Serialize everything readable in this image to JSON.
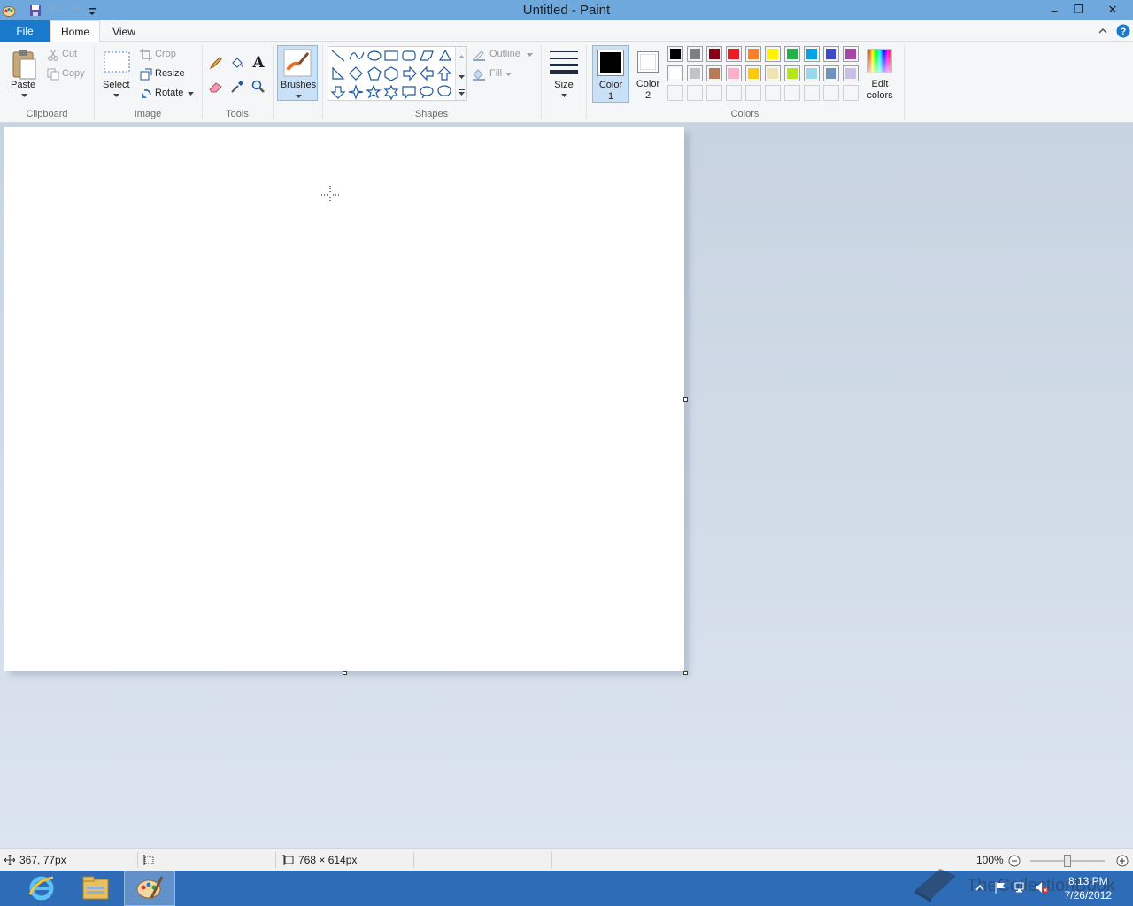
{
  "window": {
    "title": "Untitled - Paint",
    "minimize": "–",
    "restore": "❐",
    "close": "✕"
  },
  "tabs": {
    "file": "File",
    "home": "Home",
    "view": "View"
  },
  "ribbon": {
    "clipboard": {
      "label": "Clipboard",
      "paste": "Paste",
      "cut": "Cut",
      "copy": "Copy"
    },
    "image": {
      "label": "Image",
      "select": "Select",
      "crop": "Crop",
      "resize": "Resize",
      "rotate": "Rotate"
    },
    "tools": {
      "label": "Tools",
      "text_glyph": "A"
    },
    "brushes": {
      "label": "Brushes"
    },
    "shapes": {
      "label": "Shapes",
      "outline": "Outline",
      "fill": "Fill"
    },
    "size": {
      "label": "Size"
    },
    "colors": {
      "label": "Colors",
      "color1": "Color",
      "color1_num": "1",
      "color2": "Color",
      "color2_num": "2",
      "edit": "Edit",
      "edit2": "colors",
      "color1_value": "#000000",
      "color2_value": "#ffffff",
      "palette_row1": [
        "#000000",
        "#7f7f7f",
        "#880015",
        "#ed1c24",
        "#ff7f27",
        "#fff200",
        "#22b14c",
        "#00a2e8",
        "#3f48cc",
        "#a349a4"
      ],
      "palette_row2": [
        "#ffffff",
        "#c3c3c3",
        "#b97a57",
        "#ffaec9",
        "#ffc90e",
        "#efe4b0",
        "#b5e61d",
        "#99d9ea",
        "#7092be",
        "#c8bfe7"
      ],
      "palette_row3": [
        "#f5f6f7",
        "#f5f6f7",
        "#f5f6f7",
        "#f5f6f7",
        "#f5f6f7",
        "#f5f6f7",
        "#f5f6f7",
        "#f5f6f7",
        "#f5f6f7",
        "#f5f6f7"
      ]
    }
  },
  "status": {
    "cursor_pos": "367, 77px",
    "canvas_size": "768 × 614px",
    "zoom": "100%",
    "zoom_fraction": 0.5
  },
  "taskbar": {
    "time": "8:13 PM",
    "date": "7/26/2012",
    "watermark": "TheCollectionBook"
  }
}
